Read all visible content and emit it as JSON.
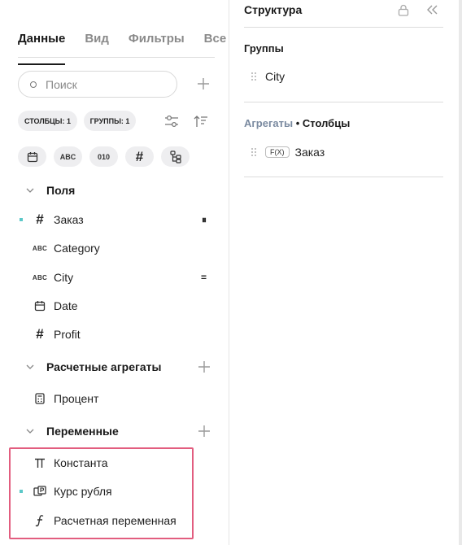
{
  "tabs": [
    {
      "label": "Данные",
      "active": true
    },
    {
      "label": "Вид",
      "active": false
    },
    {
      "label": "Фильтры",
      "active": false
    },
    {
      "label": "Все",
      "active": false
    }
  ],
  "search": {
    "placeholder": "Поиск",
    "value": ""
  },
  "chips": {
    "columns": "СТОЛБЦЫ: 1",
    "groups": "ГРУППЫ: 1"
  },
  "type_filters": {
    "abc": "ABC",
    "bool": "010"
  },
  "sections": {
    "fields": {
      "title": "Поля",
      "items": [
        {
          "label": "Заказ",
          "icon": "hash-icon",
          "selected": true,
          "trail": "⏸"
        },
        {
          "label": "Category",
          "icon": "abc-icon",
          "selected": false,
          "trail": ""
        },
        {
          "label": "City",
          "icon": "abc-icon",
          "selected": false,
          "trail": "="
        },
        {
          "label": "Date",
          "icon": "calendar-icon",
          "selected": false,
          "trail": ""
        },
        {
          "label": "Profit",
          "icon": "hash-icon",
          "selected": false,
          "trail": ""
        }
      ]
    },
    "aggregates": {
      "title": "Расчетные агрегаты",
      "items": [
        {
          "label": "Процент",
          "icon": "calculator-icon"
        }
      ]
    },
    "variables": {
      "title": "Переменные",
      "items": [
        {
          "label": "Константа",
          "icon": "pi-icon",
          "selected": false
        },
        {
          "label": "Курс рубля",
          "icon": "currency-exchange-icon",
          "selected": true
        },
        {
          "label": "Расчетная переменная",
          "icon": "function-icon",
          "selected": false
        }
      ]
    }
  },
  "structure": {
    "title": "Структура",
    "groups_label": "Группы",
    "groups_items": [
      "City"
    ],
    "aggregates_label": "Агрегаты",
    "columns_label": "• Столбцы",
    "columns_items": [
      {
        "badge": "F(X)",
        "label": "Заказ"
      }
    ]
  },
  "colors": {
    "accent_marker": "#5bc8c8",
    "highlight": "#e25d7f"
  }
}
